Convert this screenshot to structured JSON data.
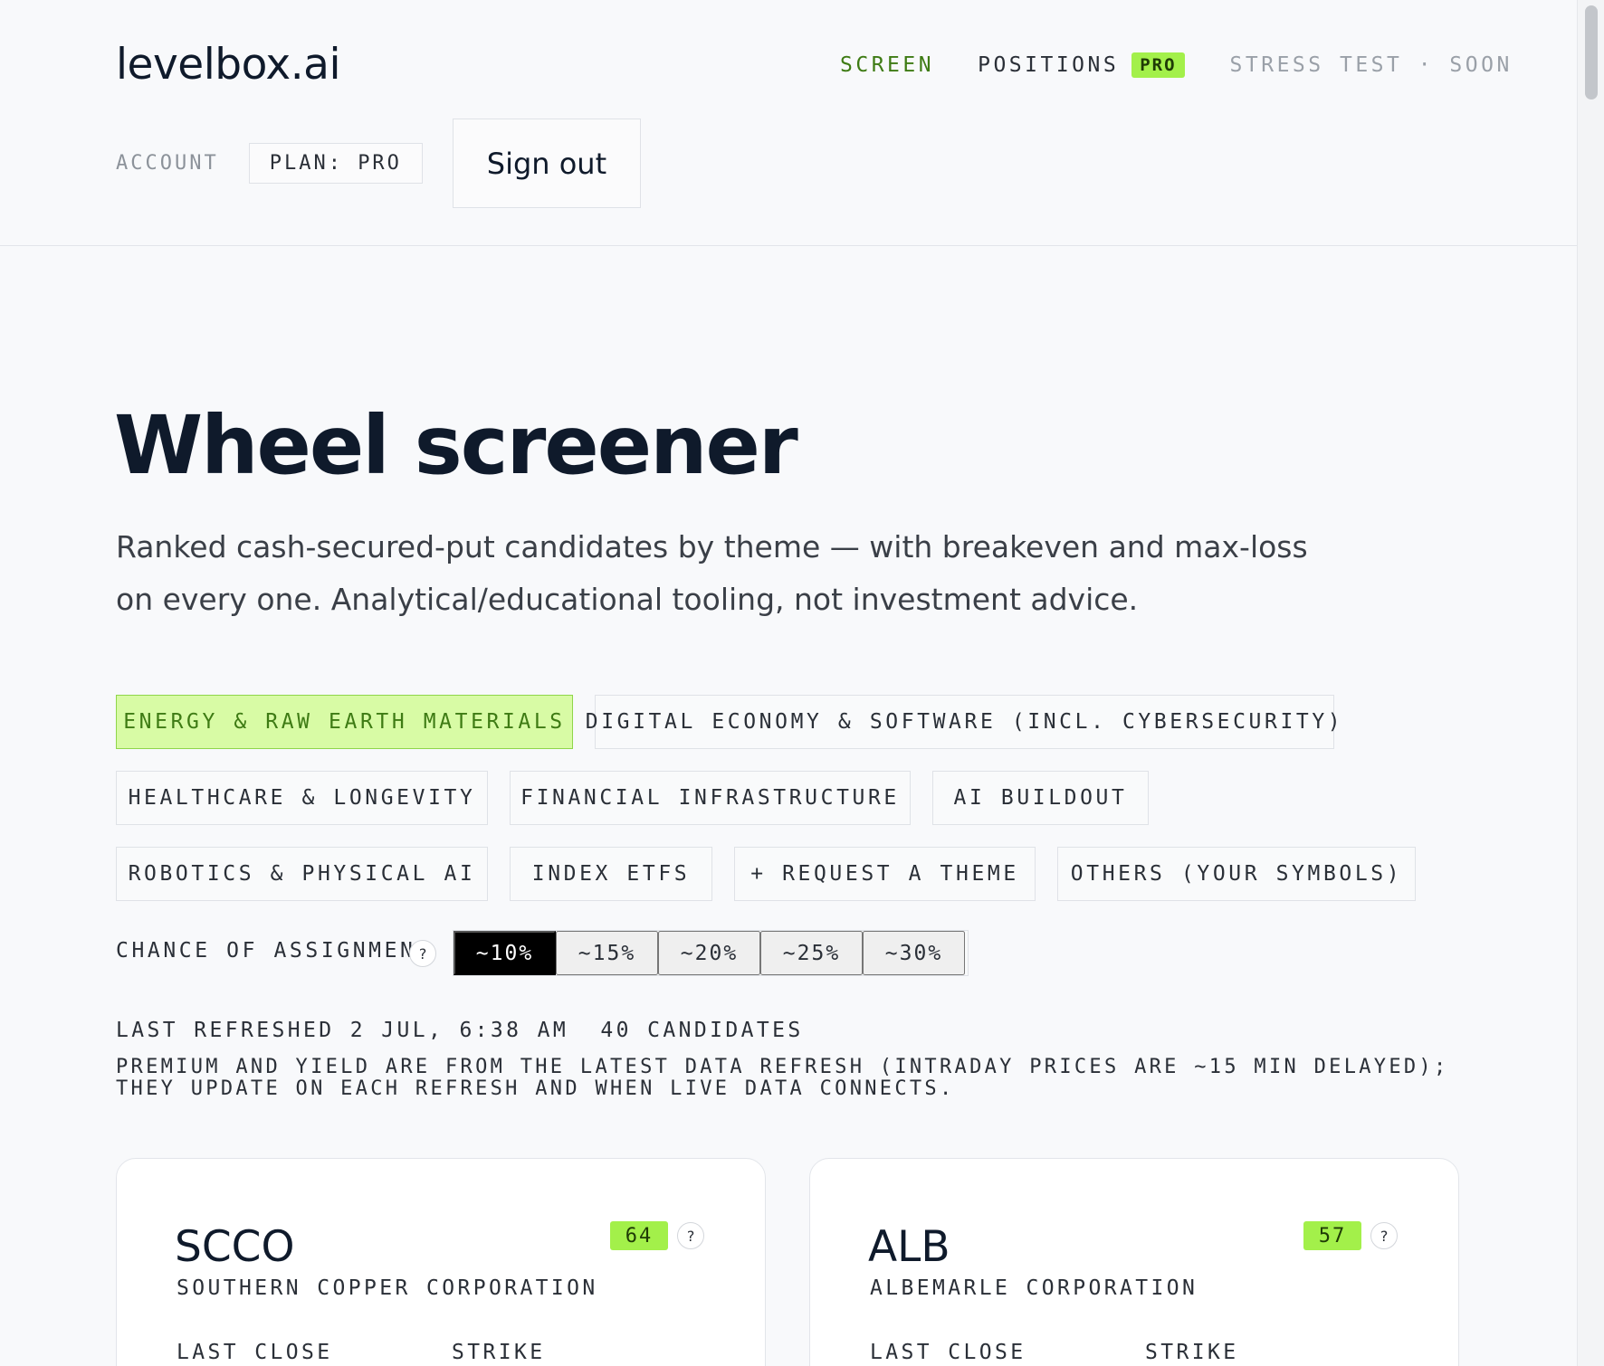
{
  "header": {
    "logo": "levelbox.ai",
    "nav": {
      "screen": "SCREEN",
      "positions": "POSITIONS",
      "positions_badge": "PRO",
      "stress_test": "STRESS TEST · SOON"
    },
    "account_label": "ACCOUNT",
    "plan": "PLAN: PRO",
    "sign_out": "Sign out"
  },
  "hero": {
    "title": "Wheel screener",
    "subtitle": "Ranked cash-secured-put candidates by theme — with breakeven and max-loss on every one. Analytical/educational tooling, not investment advice."
  },
  "themes": [
    {
      "label": "ENERGY & RAW EARTH MATERIALS",
      "active": true
    },
    {
      "label": "DIGITAL ECONOMY & SOFTWARE (INCL. CYBERSECURITY)",
      "active": false
    },
    {
      "label": "HEALTHCARE & LONGEVITY",
      "active": false
    },
    {
      "label": "FINANCIAL INFRASTRUCTURE",
      "active": false
    },
    {
      "label": "AI BUILDOUT",
      "active": false
    },
    {
      "label": "ROBOTICS & PHYSICAL AI",
      "active": false
    },
    {
      "label": "INDEX ETFS",
      "active": false
    },
    {
      "label": "+ REQUEST A THEME",
      "active": false
    },
    {
      "label": "OTHERS (YOUR SYMBOLS)",
      "active": false
    }
  ],
  "assignment": {
    "label": "CHANCE OF ASSIGNMENT",
    "help": "?",
    "options": [
      "~10%",
      "~15%",
      "~20%",
      "~25%",
      "~30%"
    ],
    "selected": "~10%"
  },
  "meta": {
    "last_refreshed": "LAST REFRESHED 2 JUL, 6:38 AM",
    "candidates": "40 CANDIDATES",
    "note": "PREMIUM AND YIELD ARE FROM THE LATEST DATA REFRESH (INTRADAY PRICES ARE ~15 MIN DELAYED); THEY UPDATE ON EACH REFRESH AND WHEN LIVE DATA CONNECTS."
  },
  "cards": [
    {
      "ticker": "SCCO",
      "name": "SOUTHERN COPPER CORPORATION",
      "score": "64",
      "help": "?",
      "last_close_label": "LAST CLOSE",
      "strike_label": "STRIKE"
    },
    {
      "ticker": "ALB",
      "name": "ALBEMARLE CORPORATION",
      "score": "57",
      "help": "?",
      "last_close_label": "LAST CLOSE",
      "strike_label": "STRIKE"
    }
  ],
  "colors": {
    "accent_green": "#a3f04a",
    "active_text_green": "#3e7b14",
    "active_chip_bg": "#d8fba5",
    "background": "#f8f9fb"
  }
}
